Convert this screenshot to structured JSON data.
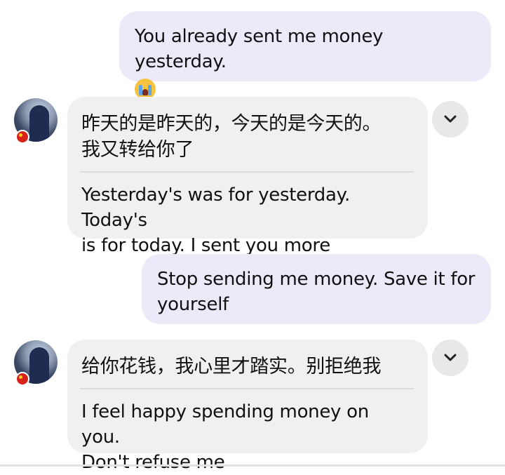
{
  "messages": [
    {
      "direction": "sent",
      "text": "You already sent me money yesterday.",
      "emoji": "crying-face"
    },
    {
      "direction": "received",
      "original_line1": "昨天的是昨天的，今天的是今天的。",
      "original_line2": "我又转给你了",
      "translation_line1": "Yesterday's was for yesterday. Today's",
      "translation_line2": "is for today. I sent you more"
    },
    {
      "direction": "sent",
      "line1": "Stop sending me money. Save it for",
      "line2": "yourself"
    },
    {
      "direction": "received",
      "original": "给你花钱，我心里才踏实。别拒绝我",
      "translation_line1": "I feel happy spending money on you.",
      "translation_line2": "Don't refuse me"
    }
  ],
  "icons": {
    "avatar": "avatar-icon",
    "flag_badge": "china-flag-icon",
    "expand": "chevron-down-icon",
    "emoji": "crying-face-icon"
  },
  "colors": {
    "sent_bubble": "#ECEAF9",
    "received_bubble": "#F0F0F0",
    "chevron_button": "#E8E8E8",
    "text": "#111111"
  }
}
